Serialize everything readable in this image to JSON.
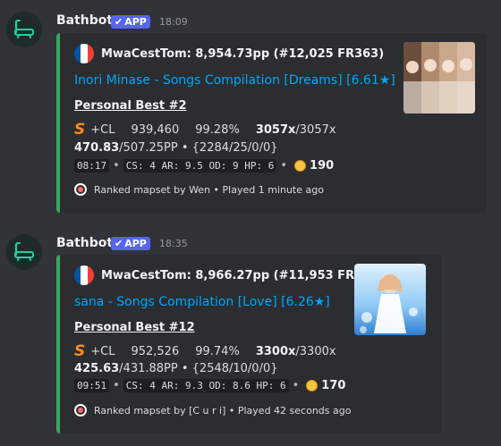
{
  "messages": [
    {
      "username": "Bathbot",
      "badge": "APP",
      "time": "18:09",
      "author": "MwaCestTom: 8,954.73pp (#12,025 FR363)",
      "title": "Inori Minase - Songs Compilation [Dreams] [6.61★]",
      "section": "Personal Best #2",
      "grade": "S",
      "mods": "+CL",
      "score": "939,460",
      "accuracy": "99.28%",
      "combo": "3057x",
      "max_combo": "/3057x",
      "pp": "470.83",
      "pp_rest": "/507.25PP • {2284/25/0/0}",
      "length": "08:17",
      "stats": "CS: 4 AR: 9.5 OD: 9 HP: 6",
      "bpm": "190",
      "footer": "Ranked mapset by Wen • Played 1 minute ago"
    },
    {
      "username": "Bathbot",
      "badge": "APP",
      "time": "18:35",
      "author": "MwaCestTom: 8,966.27pp (#11,953 FR363)",
      "title": "sana - Songs Compilation [Love] [6.26★]",
      "section": "Personal Best #12",
      "grade": "S",
      "mods": "+CL",
      "score": "952,526",
      "accuracy": "99.74%",
      "combo": "3300x",
      "max_combo": "/3300x",
      "pp": "425.63",
      "pp_rest": "/431.88PP • {2548/10/0/0}",
      "length": "09:51",
      "stats": "CS: 4 AR: 9.3 OD: 8.6 HP: 6",
      "bpm": "170",
      "footer": "Ranked mapset by [C u r i] • Played 42 seconds ago"
    }
  ],
  "colors": {
    "background": "#313338",
    "embed": "#2b2d31",
    "embed_border": "#3ba55c",
    "link": "#00a8fc",
    "badge": "#5865f2",
    "grade": "#ff8a1f"
  },
  "icons": {
    "avatar": "bathtub-icon",
    "badge": "checkmark-icon",
    "flag": "france-flag-icon",
    "bpm": "metronome-icon",
    "footer": "osu-circle-icon"
  }
}
